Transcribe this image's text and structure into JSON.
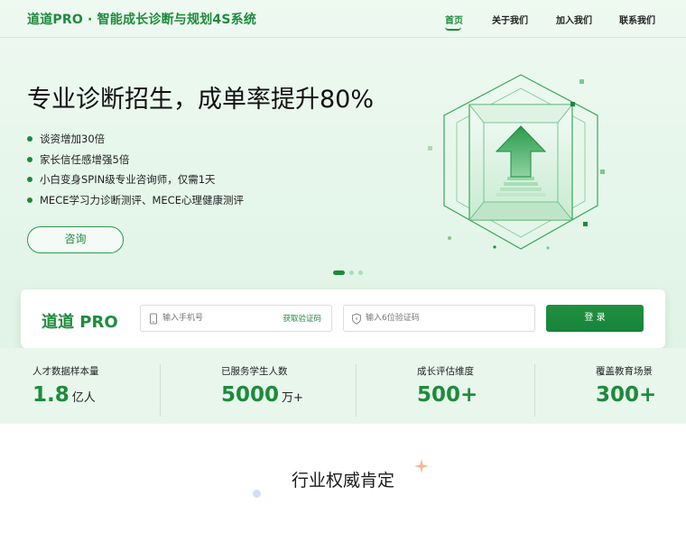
{
  "header": {
    "brand": "道道PRO · 智能成长诊断与规划4S系统",
    "nav": [
      {
        "label": "首页",
        "active": true
      },
      {
        "label": "关于我们",
        "active": false
      },
      {
        "label": "加入我们",
        "active": false
      },
      {
        "label": "联系我们",
        "active": false
      }
    ]
  },
  "hero": {
    "title": "专业诊断招生，成单率提升80%",
    "bullets": [
      "谈资增加30倍",
      "家长信任感增强5倍",
      "小白变身SPIN级专业咨询师，仅需1天",
      "MECE学习力诊断测评、MECE心理健康测评"
    ],
    "cta": "咨询",
    "carousel_active_index": 0
  },
  "login": {
    "logo": "道道 PRO",
    "phone_placeholder": "输入手机号",
    "get_code": "获取验证码",
    "code_placeholder": "输入6位验证码",
    "submit": "登 录"
  },
  "stats": [
    {
      "label": "人才数据样本量",
      "number": "1.8",
      "unit": "亿人"
    },
    {
      "label": "已服务学生人数",
      "number": "5000",
      "unit": "万+"
    },
    {
      "label": "成长评估维度",
      "number": "500+",
      "unit": ""
    },
    {
      "label": "覆盖教育场景",
      "number": "300+",
      "unit": ""
    }
  ],
  "section": {
    "title": "行业权威肯定"
  },
  "colors": {
    "primary": "#1d8b3c",
    "hero_bg": "#e3f5e8",
    "accent_spark": "#f5b78f"
  },
  "icons": {
    "phone": "phone-icon",
    "shield": "shield-icon",
    "arrow": "arrow-up-icon"
  }
}
